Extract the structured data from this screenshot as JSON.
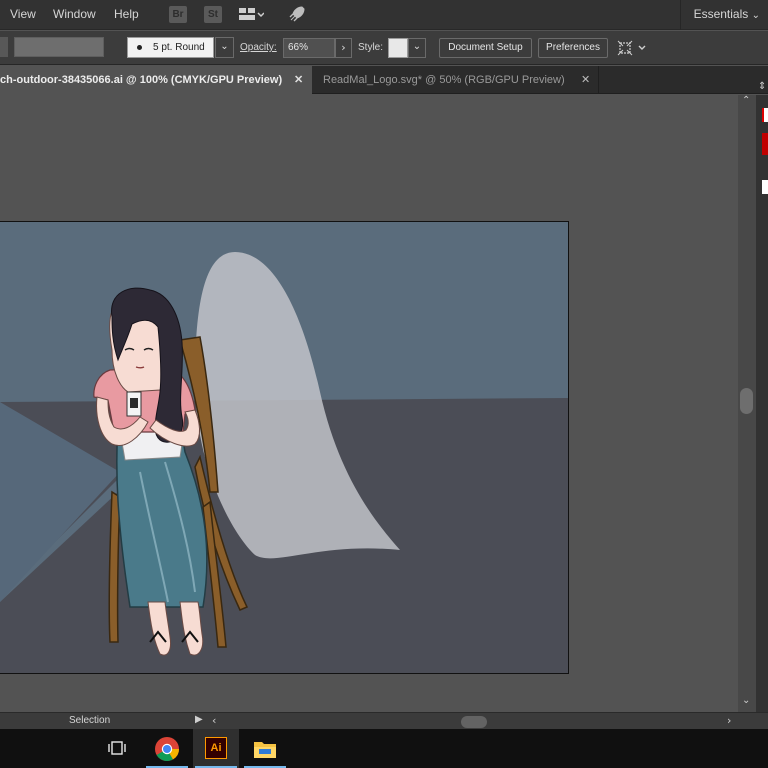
{
  "menu": {
    "view": "View",
    "window": "Window",
    "help": "Help"
  },
  "toolbar_icons": {
    "bridge": "Br",
    "stock": "St"
  },
  "workspace": "Essentials",
  "control": {
    "stroke_profile": "5 pt. Round",
    "opacity_label": "Opacity:",
    "opacity_value": "66%",
    "style_label": "Style:",
    "document_setup": "Document Setup",
    "preferences": "Preferences"
  },
  "tabs": [
    {
      "label": "ch-outdoor-38435066.ai @ 100% (CMYK/GPU Preview)",
      "active": true
    },
    {
      "label": "ReadMal_Logo.svg* @ 50% (RGB/GPU Preview)",
      "active": false
    }
  ],
  "status": {
    "tool": "Selection"
  },
  "taskbar": [
    "task-view",
    "chrome",
    "illustrator",
    "file-explorer"
  ],
  "colors": {
    "sky": "#5a6c7c",
    "floor": "#4b4d56",
    "glow": "#c6c7cd",
    "shirt": "#e89aa1",
    "skirt": "#4a7a8a",
    "chair": "#8a5e2a",
    "hair": "#2d2935"
  }
}
